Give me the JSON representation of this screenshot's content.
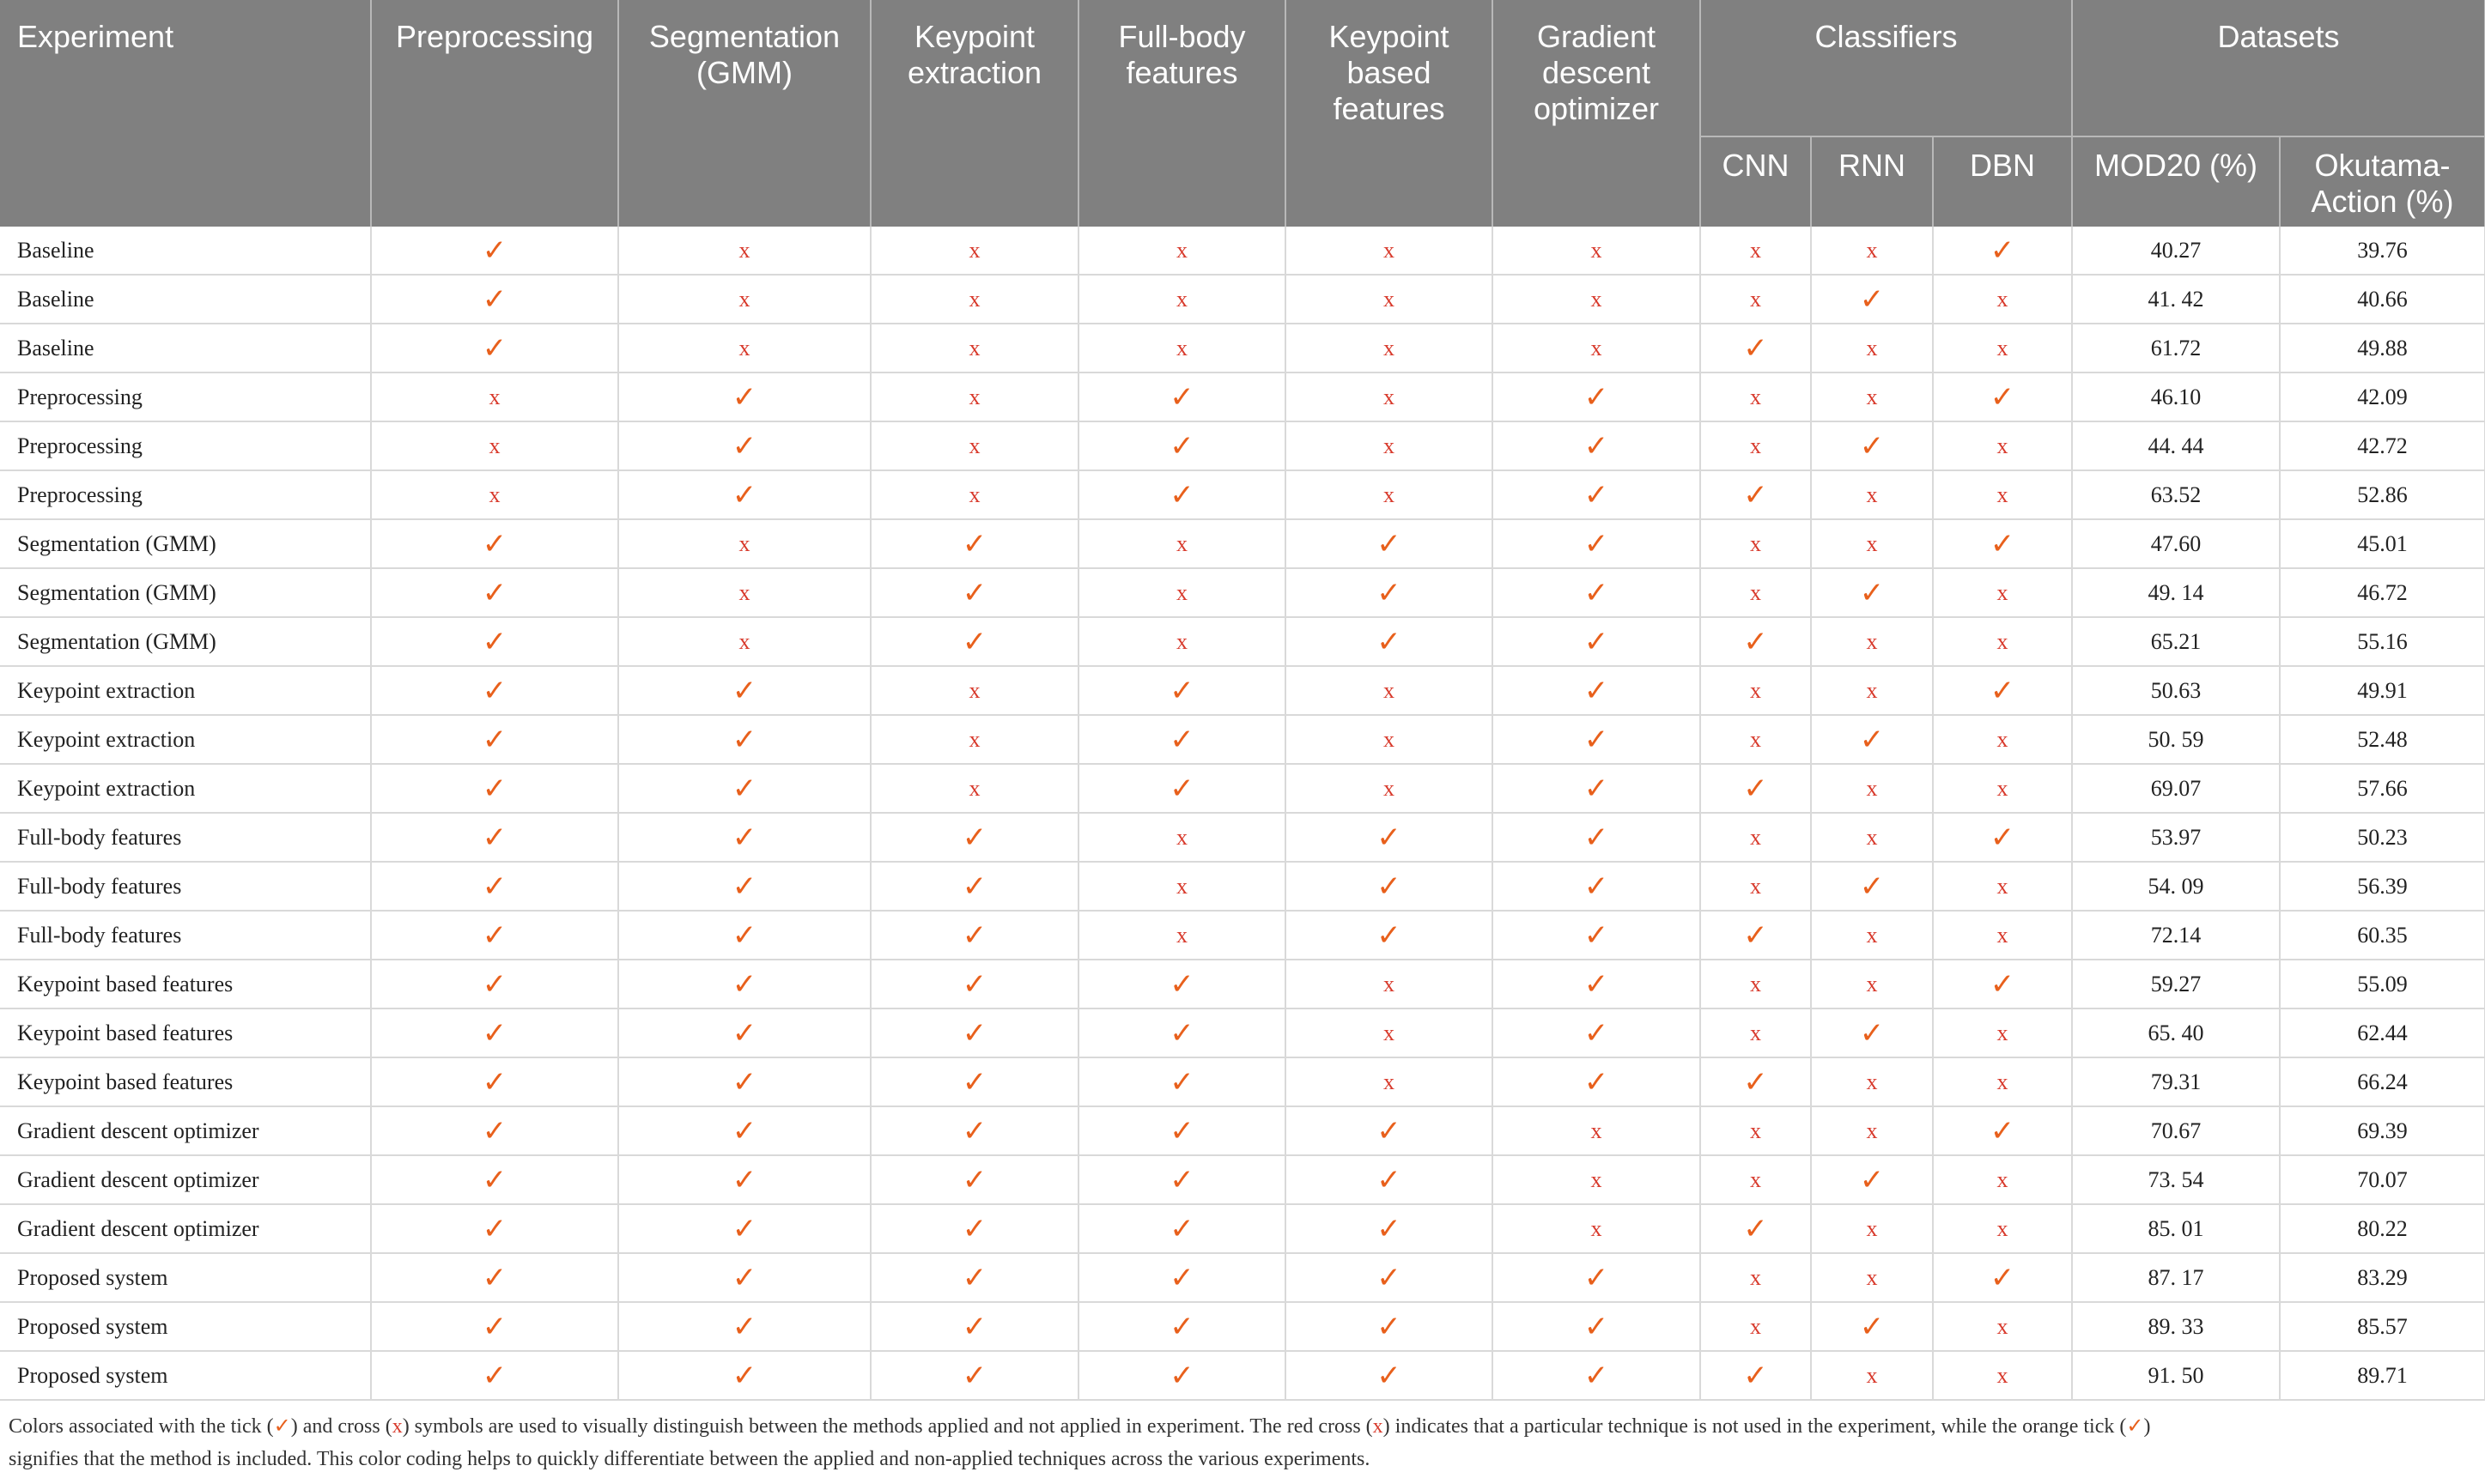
{
  "header": {
    "experiment": "Experiment",
    "preprocessing": "Preprocessing",
    "segmentation": "Segmentation (GMM)",
    "keypoint_extraction": "Keypoint extraction",
    "full_body": "Full-body features",
    "keypoint_based": "Keypoint based features",
    "gradient": "Gradient descent optimizer",
    "classifiers": "Classifiers",
    "datasets": "Datasets",
    "cnn": "CNN",
    "rnn": "RNN",
    "dbn": "DBN",
    "mod20": "MOD20 (%)",
    "okutama": "Okutama-Action (%)"
  },
  "symbols": {
    "tick": "✓",
    "cross": "x"
  },
  "colors": {
    "tick": "#e8601c",
    "cross": "#d83a2c",
    "header_bg": "#808080"
  },
  "rows": [
    {
      "exp": "Baseline",
      "f": [
        1,
        0,
        0,
        0,
        0,
        0,
        0,
        0,
        1
      ],
      "mod20": "40.27",
      "okutama": "39.76"
    },
    {
      "exp": "Baseline",
      "f": [
        1,
        0,
        0,
        0,
        0,
        0,
        0,
        1,
        0
      ],
      "mod20": "41. 42",
      "okutama": "40.66"
    },
    {
      "exp": "Baseline",
      "f": [
        1,
        0,
        0,
        0,
        0,
        0,
        1,
        0,
        0
      ],
      "mod20": "61.72",
      "okutama": "49.88"
    },
    {
      "exp": "Preprocessing",
      "f": [
        0,
        1,
        0,
        1,
        0,
        1,
        0,
        0,
        1
      ],
      "mod20": "46.10",
      "okutama": "42.09"
    },
    {
      "exp": "Preprocessing",
      "f": [
        0,
        1,
        0,
        1,
        0,
        1,
        0,
        1,
        0
      ],
      "mod20": "44. 44",
      "okutama": "42.72"
    },
    {
      "exp": "Preprocessing",
      "f": [
        0,
        1,
        0,
        1,
        0,
        1,
        1,
        0,
        0
      ],
      "mod20": "63.52",
      "okutama": "52.86"
    },
    {
      "exp": "Segmentation (GMM)",
      "f": [
        1,
        0,
        1,
        0,
        1,
        1,
        0,
        0,
        1
      ],
      "mod20": "47.60",
      "okutama": "45.01"
    },
    {
      "exp": "Segmentation (GMM)",
      "f": [
        1,
        0,
        1,
        0,
        1,
        1,
        0,
        1,
        0
      ],
      "mod20": "49. 14",
      "okutama": "46.72"
    },
    {
      "exp": "Segmentation (GMM)",
      "f": [
        1,
        0,
        1,
        0,
        1,
        1,
        1,
        0,
        0
      ],
      "mod20": "65.21",
      "okutama": "55.16"
    },
    {
      "exp": "Keypoint extraction",
      "f": [
        1,
        1,
        0,
        1,
        0,
        1,
        0,
        0,
        1
      ],
      "mod20": "50.63",
      "okutama": "49.91"
    },
    {
      "exp": "Keypoint extraction",
      "f": [
        1,
        1,
        0,
        1,
        0,
        1,
        0,
        1,
        0
      ],
      "mod20": "50. 59",
      "okutama": "52.48"
    },
    {
      "exp": "Keypoint extraction",
      "f": [
        1,
        1,
        0,
        1,
        0,
        1,
        1,
        0,
        0
      ],
      "mod20": "69.07",
      "okutama": "57.66"
    },
    {
      "exp": "Full-body features",
      "f": [
        1,
        1,
        1,
        0,
        1,
        1,
        0,
        0,
        1
      ],
      "mod20": "53.97",
      "okutama": "50.23"
    },
    {
      "exp": "Full-body features",
      "f": [
        1,
        1,
        1,
        0,
        1,
        1,
        0,
        1,
        0
      ],
      "mod20": "54. 09",
      "okutama": "56.39"
    },
    {
      "exp": "Full-body features",
      "f": [
        1,
        1,
        1,
        0,
        1,
        1,
        1,
        0,
        0
      ],
      "mod20": "72.14",
      "okutama": "60.35"
    },
    {
      "exp": "Keypoint based features",
      "f": [
        1,
        1,
        1,
        1,
        0,
        1,
        0,
        0,
        1
      ],
      "mod20": "59.27",
      "okutama": "55.09"
    },
    {
      "exp": "Keypoint based features",
      "f": [
        1,
        1,
        1,
        1,
        0,
        1,
        0,
        1,
        0
      ],
      "mod20": "65. 40",
      "okutama": "62.44"
    },
    {
      "exp": "Keypoint based features",
      "f": [
        1,
        1,
        1,
        1,
        0,
        1,
        1,
        0,
        0
      ],
      "mod20": "79.31",
      "okutama": "66.24"
    },
    {
      "exp": "Gradient descent optimizer",
      "f": [
        1,
        1,
        1,
        1,
        1,
        0,
        0,
        0,
        1
      ],
      "mod20": "70.67",
      "okutama": "69.39"
    },
    {
      "exp": "Gradient descent optimizer",
      "f": [
        1,
        1,
        1,
        1,
        1,
        0,
        0,
        1,
        0
      ],
      "mod20": "73. 54",
      "okutama": "70.07"
    },
    {
      "exp": "Gradient descent optimizer",
      "f": [
        1,
        1,
        1,
        1,
        1,
        0,
        1,
        0,
        0
      ],
      "mod20": "85. 01",
      "okutama": "80.22"
    },
    {
      "exp": "Proposed system",
      "f": [
        1,
        1,
        1,
        1,
        1,
        1,
        0,
        0,
        1
      ],
      "mod20": "87. 17",
      "okutama": "83.29"
    },
    {
      "exp": "Proposed system",
      "f": [
        1,
        1,
        1,
        1,
        1,
        1,
        0,
        1,
        0
      ],
      "mod20": "89. 33",
      "okutama": "85.57"
    },
    {
      "exp": "Proposed system",
      "f": [
        1,
        1,
        1,
        1,
        1,
        1,
        1,
        0,
        0
      ],
      "mod20": "91. 50",
      "okutama": "89.71"
    }
  ],
  "footnote": {
    "p1": "Colors associated with the tick (",
    "p2": ") and cross (",
    "p3": ") symbols are used to visually distinguish between the methods applied and not applied in experiment. The red cross (",
    "p4": ") indicates that a particular technique is not used in the experiment, while the orange tick (",
    "p5": ")",
    "p6": "signifies that the method is included. This color coding helps to quickly differentiate between the applied and non-applied techniques across the various experiments."
  }
}
